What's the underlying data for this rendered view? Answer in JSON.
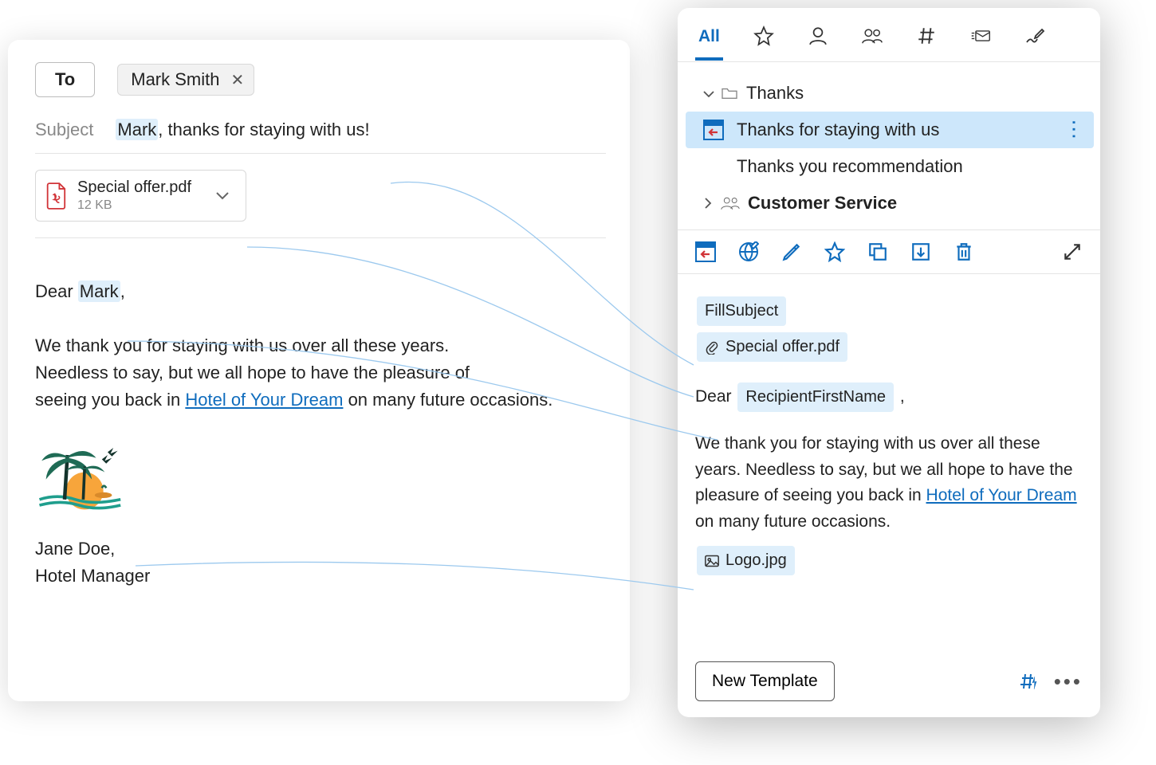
{
  "compose": {
    "to_label": "To",
    "recipient": "Mark Smith",
    "subject_label": "Subject",
    "subject_hl": "Mark",
    "subject_rest": ", thanks for staying with us!",
    "attachment": {
      "name": "Special offer.pdf",
      "size": "12 KB"
    },
    "greet_pre": "Dear ",
    "greet_hl": "Mark",
    "greet_post": ",",
    "body_l1": "We thank you for staying with us over all these years.",
    "body_l2": "Needless to say, but we all hope to have the pleasure of",
    "body_l3a": "seeing you back in ",
    "body_link": "Hotel of Your Dream",
    "body_l3b": " on many future occasions.",
    "sig_name": "Jane Doe,",
    "sig_title": "Hotel Manager"
  },
  "panel": {
    "tab_all": "All",
    "tree": {
      "folder1": "Thanks",
      "item1": "Thanks for staying with us",
      "item2": "Thanks you recommendation",
      "folder2": "Customer Service"
    },
    "preview": {
      "fill_subject": "FillSubject",
      "attachment": "Special offer.pdf",
      "dear": "Dear",
      "recipient_token": "RecipientFirstName",
      "comma": ",",
      "body_a": "We thank you for staying with us over all these years. Needless to say, but we all hope to have the pleasure of seeing you back in ",
      "body_link": "Hotel of Your Dream",
      "body_b": " on many future occasions.",
      "logo": "Logo.jpg"
    },
    "new_template": "New Template"
  }
}
